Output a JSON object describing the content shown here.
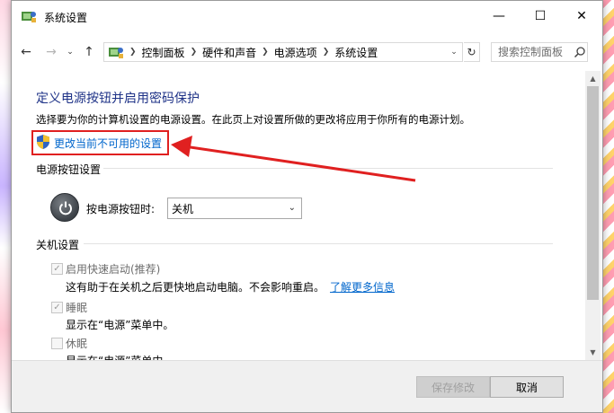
{
  "window": {
    "title": "系统设置"
  },
  "titlebar": {
    "minimize": "—",
    "maximize": "☐",
    "close": "✕"
  },
  "nav": {
    "breadcrumb": [
      "控制面板",
      "硬件和声音",
      "电源选项",
      "系统设置"
    ],
    "search_placeholder": "搜索控制面板"
  },
  "main": {
    "title": "定义电源按钮并启用密码保护",
    "description": "选择要为你的计算机设置的电源设置。在此页上对设置所做的更改将应用于你所有的电源计划。",
    "change_link": "更改当前不可用的设置",
    "power_section": {
      "heading": "电源按钮设置",
      "field_label": "按电源按钮时:",
      "selected_value": "关机"
    },
    "shutdown_section": {
      "heading": "关机设置",
      "items": [
        {
          "label": "启用快速启动(推荐)",
          "checked": true,
          "desc": "这有助于在关机之后更快地启动电脑。不会影响重启。",
          "link": "了解更多信息"
        },
        {
          "label": "睡眠",
          "checked": true,
          "desc": "显示在“电源”菜单中。"
        },
        {
          "label": "休眠",
          "checked": false,
          "desc": "显示在“电源”菜单中。"
        }
      ]
    }
  },
  "footer": {
    "save": "保存修改",
    "cancel": "取消"
  },
  "colors": {
    "title_blue": "#1e3287",
    "link_blue": "#0066cc",
    "annotation_red": "#e02020"
  }
}
